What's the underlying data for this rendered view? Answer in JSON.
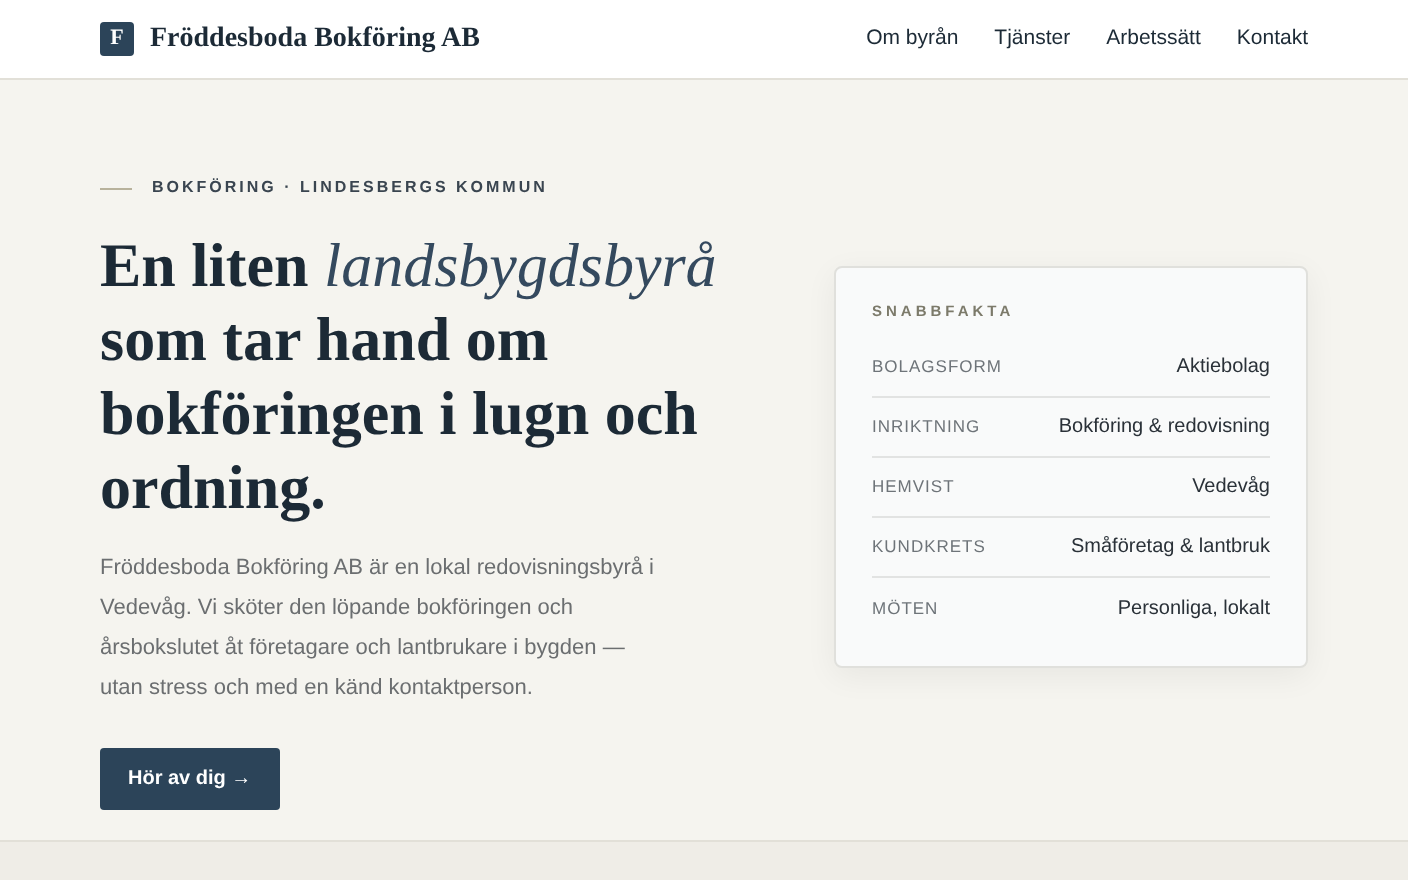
{
  "header": {
    "logo_letter": "F",
    "brand": "Fröddesboda Bokföring AB",
    "nav": [
      "Om byrån",
      "Tjänster",
      "Arbetssätt",
      "Kontakt"
    ]
  },
  "hero": {
    "kicker": "BOKFÖRING · LINDESBERGS KOMMUN",
    "headline": "En liten *landsbygdsbyrå* som tar hand om bokföringen i lugn och ordning.",
    "intro": "Fröddesboda Bokföring AB är en lokal redovisningsbyrå i Vedevåg. Vi sköter den löpande bokföringen och årsbokslutet åt företagare och lantbrukare i bygden — utan stress och med en känd kontaktperson.",
    "button": "Hör av dig →"
  },
  "facts": {
    "title": "SNABBFAKTA",
    "rows": [
      {
        "label": "BOLAGSFORM",
        "value": "Aktiebolag"
      },
      {
        "label": "INRIKTNING",
        "value": "Bokföring & redovisning"
      },
      {
        "label": "HEMVIST",
        "value": "Vedevåg"
      },
      {
        "label": "KUNDKRETS",
        "value": "Småföretag & lantbruk"
      },
      {
        "label": "MÖTEN",
        "value": "Personliga, lokalt"
      }
    ]
  }
}
